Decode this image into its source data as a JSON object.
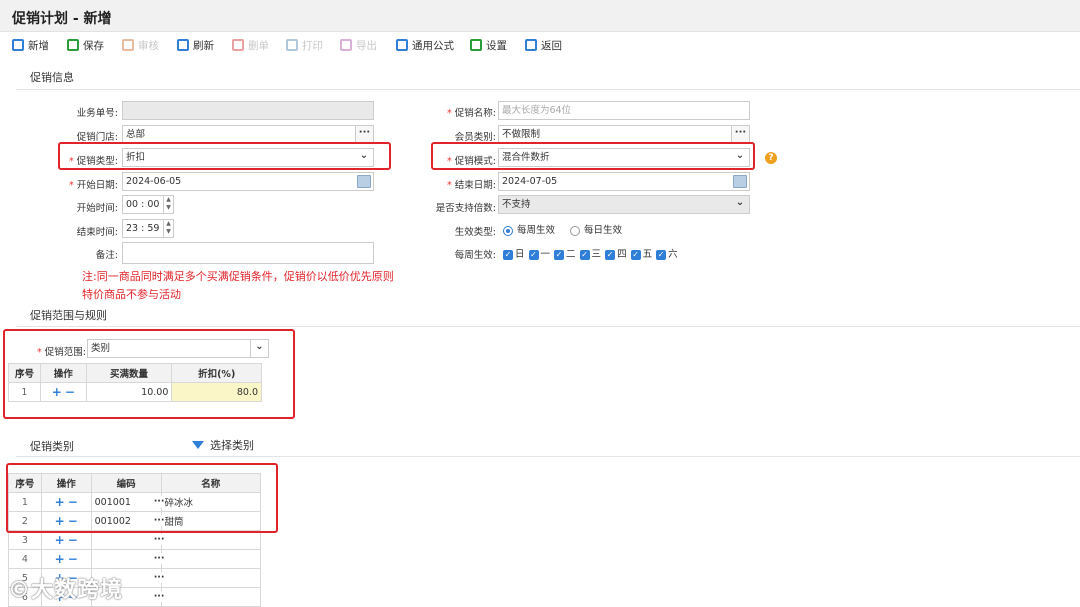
{
  "window": {
    "title": "促销计划 - 新增"
  },
  "toolbar": [
    {
      "label": "新增",
      "enabled": true,
      "icon": "add-doc-icon",
      "color": "#2f7fd8"
    },
    {
      "label": "保存",
      "enabled": true,
      "icon": "save-icon",
      "color": "#2a9d3b"
    },
    {
      "label": "审核",
      "enabled": false,
      "icon": "audit-icon",
      "color": "#e9b9a0"
    },
    {
      "label": "刷新",
      "enabled": true,
      "icon": "refresh-icon",
      "color": "#2f7fd8"
    },
    {
      "label": "删单",
      "enabled": false,
      "icon": "delete-doc-icon",
      "color": "#e9a0a0"
    },
    {
      "label": "打印",
      "enabled": false,
      "icon": "print-icon",
      "color": "#b0c8dc"
    },
    {
      "label": "导出",
      "enabled": false,
      "icon": "export-icon",
      "color": "#d8b0d8"
    },
    {
      "label": "通用公式",
      "enabled": true,
      "icon": "formula-icon",
      "color": "#2f7fd8"
    },
    {
      "label": "设置",
      "enabled": true,
      "icon": "settings-icon",
      "color": "#2a9d3b"
    },
    {
      "label": "返回",
      "enabled": true,
      "icon": "return-icon",
      "color": "#2f7fd8"
    }
  ],
  "info": {
    "section_title": "促销信息",
    "doc_no_label": "业务单号:",
    "doc_no_value": "",
    "store_label": "促销门店:",
    "store_value": "总部",
    "type_label": "促销类型:",
    "type_value": "折扣",
    "start_date_label": "开始日期:",
    "start_date_value": "2024-06-05",
    "start_time_label": "开始时间:",
    "start_time_value": "00 : 00",
    "end_time_label": "结束时间:",
    "end_time_value": "23 : 59",
    "remark_label": "备注:",
    "remark_value": "",
    "name_label": "促销名称:",
    "name_placeholder": "最大长度为64位",
    "member_label": "会员类别:",
    "member_value": "不做限制",
    "mode_label": "促销模式:",
    "mode_value": "混合件数折",
    "end_date_label": "结束日期:",
    "end_date_value": "2024-07-05",
    "multiple_label": "是否支持倍数:",
    "multiple_value": "不支持",
    "effect_type_label": "生效类型:",
    "effect_weekly": "每周生效",
    "effect_daily": "每日生效",
    "weekly_label": "每周生效:",
    "weekdays": [
      "日",
      "一",
      "二",
      "三",
      "四",
      "五",
      "六"
    ],
    "note_line1": "注:同一商品同时满足多个买满促销条件，促销价以低价优先原则",
    "note_line2": "特价商品不参与活动"
  },
  "scope": {
    "section_title": "促销范围与规则",
    "scope_label": "促销范围:",
    "scope_value": "类别",
    "headers": [
      "序号",
      "操作",
      "买满数量",
      "折扣(%)"
    ],
    "rows": [
      {
        "no": "1",
        "qty": "10.00",
        "discount": "80.0"
      }
    ]
  },
  "category": {
    "section_title": "促销类别",
    "select_label": "选择类别",
    "headers": [
      "序号",
      "操作",
      "编码",
      "名称"
    ],
    "rows": [
      {
        "no": "1",
        "code": "001001",
        "name": "碎冰冰"
      },
      {
        "no": "2",
        "code": "001002",
        "name": "甜筒"
      },
      {
        "no": "3",
        "code": "",
        "name": ""
      },
      {
        "no": "4",
        "code": "",
        "name": ""
      },
      {
        "no": "5",
        "code": "",
        "name": ""
      },
      {
        "no": "6",
        "code": "",
        "name": ""
      }
    ]
  },
  "watermark": "大数跨境"
}
